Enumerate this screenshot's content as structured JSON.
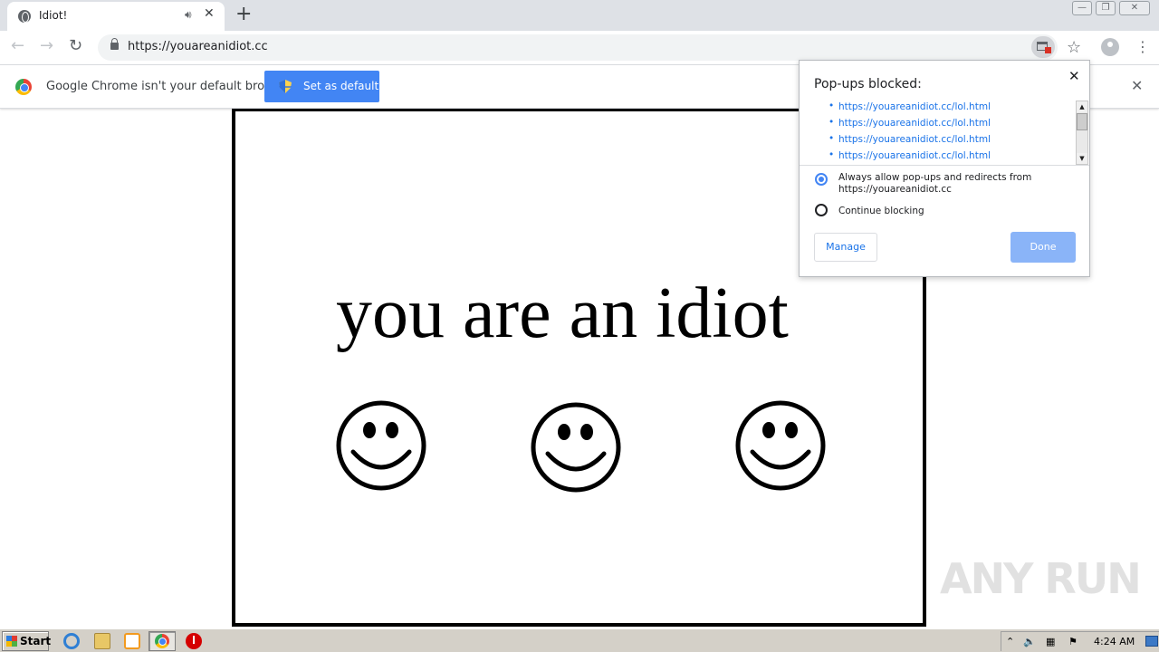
{
  "browser": {
    "tab": {
      "title": "Idiot!",
      "audio_icon": "speaker-icon",
      "close_glyph": "✕"
    },
    "new_tab_glyph": "+",
    "window_controls": {
      "minimize": "—",
      "maximize": "❐",
      "close": "✕"
    },
    "nav": {
      "back": "←",
      "forward": "→",
      "reload": "↻"
    },
    "address": {
      "url": "https://youareanidiot.cc"
    },
    "toolbar_icons": {
      "star": "☆",
      "menu": "⋮"
    }
  },
  "infobar": {
    "message": "Google Chrome isn't your default browser",
    "button_label": "Set as default",
    "close_glyph": "✕"
  },
  "page": {
    "headline": "you are an idiot",
    "smiley_count": 3
  },
  "popup_bubble": {
    "title": "Pop-ups blocked:",
    "close_glyph": "✕",
    "blocked_urls": [
      "https://youareanidiot.cc/lol.html",
      "https://youareanidiot.cc/lol.html",
      "https://youareanidiot.cc/lol.html",
      "https://youareanidiot.cc/lol.html"
    ],
    "options": [
      {
        "label": "Always allow pop-ups and redirects from https://youareanidiot.cc",
        "selected": true
      },
      {
        "label": "Continue blocking",
        "selected": false
      }
    ],
    "manage_label": "Manage",
    "done_label": "Done",
    "scroll_up": "▲",
    "scroll_down": "▼"
  },
  "watermark": "ANY RUN",
  "taskbar": {
    "start_label": "Start",
    "clock": "4:24 AM",
    "tray_glyphs": {
      "up": "⌃",
      "speaker": "🔈",
      "network": "▦",
      "flag": "⚑"
    }
  },
  "colors": {
    "accent": "#4285f4",
    "link": "#1a73e8",
    "done_disabled": "#8ab4f8",
    "taskbar": "#d4d0c8"
  }
}
